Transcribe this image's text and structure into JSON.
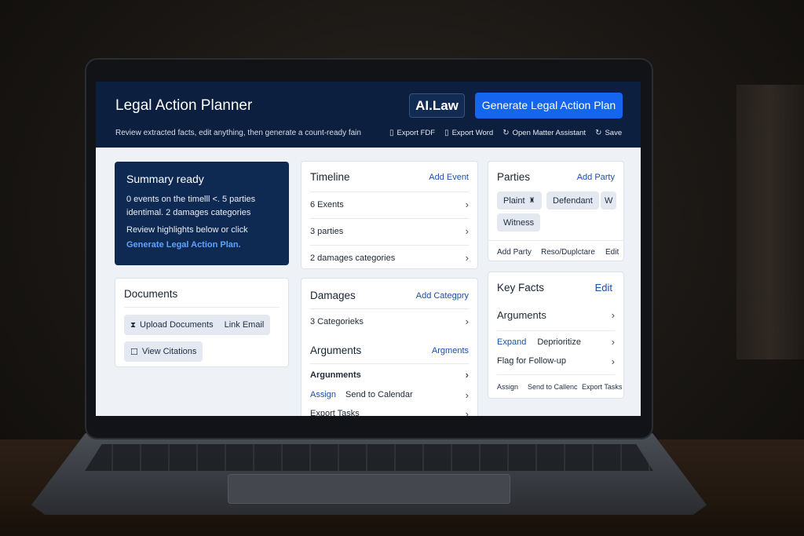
{
  "header": {
    "title": "Legal Action Planner",
    "brand": "AI.Law",
    "generate_button": "Generate Legal Action Plan",
    "subtitle": "Review extracted facts, edit anything, then generate a count-ready fain",
    "actions": [
      "Export FDF",
      "Export Word",
      "Open Matter Assistant",
      "Save"
    ]
  },
  "summary": {
    "title": "Summary ready",
    "line1": "0 events on the timelll <. 5 parties",
    "line2": "identimal. 2 damages categories",
    "line3": "Review highlights below or click",
    "cta": "Generate Legal Action Plan."
  },
  "documents": {
    "title": "Documents",
    "upload": "Upload Documents",
    "link_email": "Link Email",
    "view_citations": "View Citations"
  },
  "timeline": {
    "title": "Timeline",
    "add": "Add Event",
    "rows": [
      "6 Exents",
      "3 parties",
      "2 damages categories"
    ]
  },
  "damages": {
    "title": "Damages",
    "add": "Add Categpry",
    "rows": [
      "3 Categorieks"
    ]
  },
  "arguments_mid": {
    "title": "Arguments",
    "link": "Argments",
    "row1": "Argunments",
    "assign": "Assign",
    "send": "Send to Calendar",
    "export": "Export Tasks"
  },
  "parties": {
    "title": "Parties",
    "add": "Add Party",
    "chips": [
      "Plaint",
      "Defendant",
      "W",
      "Witness"
    ],
    "actions": [
      "Add Party",
      "Reso/Duplctare",
      "Edit"
    ]
  },
  "key_facts": {
    "title": "Key Facts",
    "edit": "Edit",
    "arguments": "Arguments",
    "expand": "Expand",
    "deprioritize": "Deprioritize",
    "flag": "Flag for Follow-up",
    "actions": [
      "Assign",
      "Send to Callenc",
      "Export Tasks"
    ]
  },
  "colors": {
    "header_bg": "#0c1f3f",
    "accent": "#1565f0",
    "summary_bg": "#0f2a52",
    "link": "#1b4fa8"
  }
}
